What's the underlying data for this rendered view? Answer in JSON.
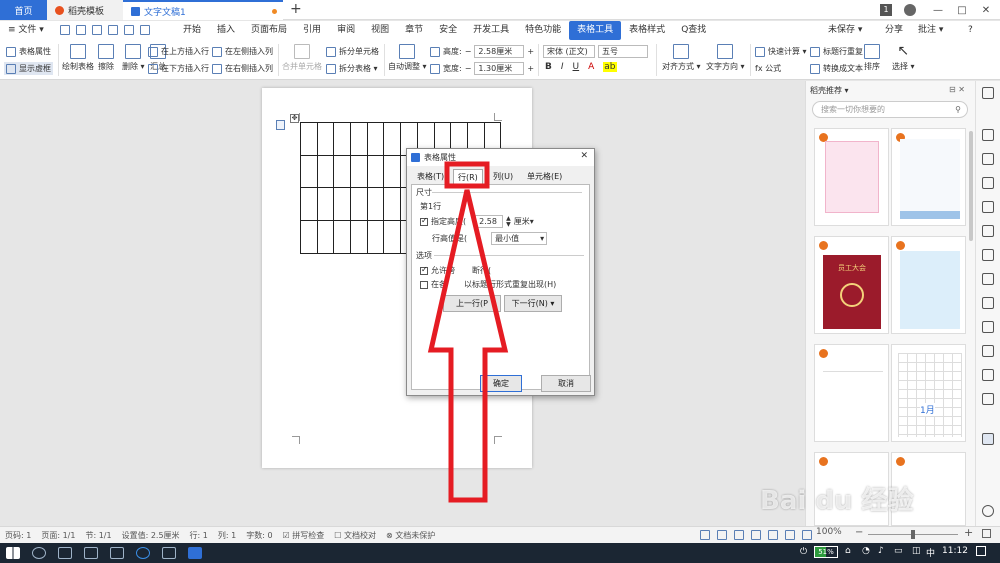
{
  "titlebar": {
    "tabs": [
      {
        "label": "首页"
      },
      {
        "label": "稻壳模板"
      },
      {
        "label": "文字文稿1"
      }
    ],
    "add_tab": "+",
    "badge": "1",
    "window_controls": [
      "—",
      "□",
      "✕"
    ]
  },
  "menubar": {
    "file": "≡ 文件 ▾",
    "items": [
      "开始",
      "插入",
      "页面布局",
      "引用",
      "审阅",
      "视图",
      "章节",
      "安全",
      "开发工具",
      "特色功能",
      "表格工具",
      "表格样式"
    ],
    "active": "表格工具",
    "search": "Q查找",
    "unsaved": "未保存 ▾",
    "share": "分享",
    "annotate": "批注 ▾"
  },
  "ribbon": {
    "table_props": "表格属性",
    "show_gridlines": "显示虚框",
    "draw_table": "绘制表格",
    "erase": "擦除",
    "delete": "删除 ▾",
    "summary": "汇总",
    "insert_above": "在上方插入行",
    "insert_below": "在下方插入行",
    "insert_left": "在左侧插入列",
    "insert_right": "在右侧插入列",
    "merge_cells": "合并单元格",
    "split_cells": "拆分单元格",
    "split_table": "拆分表格 ▾",
    "auto_fit": "自动调整 ▾",
    "height_label": "高度:",
    "height_value": "2.58厘米",
    "width_label": "宽度:",
    "width_value": "1.30厘米",
    "font_name": "宋体 (正文)",
    "font_size": "五号",
    "bold": "B",
    "italic": "I",
    "underline": "U",
    "align": "对齐方式 ▾",
    "text_direction": "文字方向 ▾",
    "quick_calc": "快速计算 ▾",
    "header_repeat": "标题行重复",
    "formula": "fx 公式",
    "to_text": "转换成文本",
    "sort": "排序",
    "select": "选择 ▾"
  },
  "dialog": {
    "title": "表格属性",
    "close": "✕",
    "tabs": [
      "表格(T)",
      "行(R)",
      "列(U)",
      "单元格(E)"
    ],
    "selected_tab": "行(R)",
    "section_size": "尺寸",
    "row_label": "第1行",
    "specify_height": "指定高度(",
    "height_value": "2.58",
    "height_unit": "厘米▾",
    "row_height_mode_label": "行高值是(",
    "row_height_mode_value": "最小值",
    "section_options": "选项",
    "allow_break": "允许跨",
    "allow_break_tail": "断行(",
    "repeat_header": "在各",
    "repeat_header_tail": "以标题行形式重复出现(H)",
    "prev_row": "上一行(P",
    "next_row": "下一行(N) ▾",
    "ok": "确定",
    "cancel": "取消"
  },
  "sidebar": {
    "title": "稻壳推荐 ▾",
    "search_placeholder": "搜索一切你想要的",
    "thumb_texts": [
      "",
      "",
      "员工大会",
      "",
      "",
      "1月"
    ]
  },
  "statusbar": {
    "page": "页码: 1",
    "pages": "页面: 1/1",
    "section": "节: 1/1",
    "setting": "设置值: 2.5厘米",
    "row": "行: 1",
    "col": "列: 1",
    "words": "字数: 0",
    "spell": "拼写检查",
    "proof": "文档校对",
    "protect": "文档未保护",
    "zoom": "100%"
  },
  "taskbar": {
    "battery": "51%",
    "lang": "中",
    "time": "11:12"
  },
  "watermark": "Bai du 经验"
}
